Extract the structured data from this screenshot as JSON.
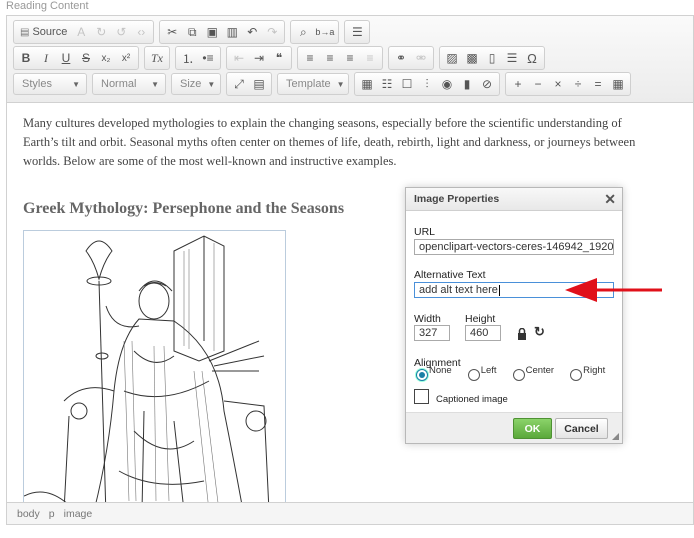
{
  "field_label": "Reading Content",
  "toolbar": {
    "row1": [
      {
        "name": "source-button",
        "label": "Source",
        "icon": "source-icon"
      },
      {
        "name": "cut-button",
        "label": "✂",
        "icon": "cut-icon"
      },
      {
        "name": "copy-button",
        "label": "⧉",
        "icon": "copy-icon"
      },
      {
        "name": "paste-button",
        "label": "📋",
        "icon": "paste-icon"
      },
      {
        "name": "paste-text-button",
        "label": "📄",
        "icon": "paste-text-icon"
      },
      {
        "name": "undo-button",
        "label": "↶",
        "icon": "undo-icon"
      },
      {
        "name": "redo-button",
        "label": "↷",
        "icon": "redo-icon"
      },
      {
        "name": "find-button",
        "label": "🔍",
        "icon": "find-icon"
      },
      {
        "name": "replace-button",
        "label": "ab",
        "icon": "replace-icon"
      },
      {
        "name": "select-all-button",
        "label": "☰",
        "icon": "select-all-icon"
      }
    ],
    "bold": "B",
    "italic": "I",
    "underline": "U",
    "strike": "S",
    "subscript": "x₂",
    "superscript": "x²",
    "remove_format": "Tx",
    "special_char": "Ω",
    "styles_label": "Styles",
    "format_label": "Normal",
    "size_label": "Size",
    "template_label": "Template",
    "math_plus": "+",
    "math_minus": "−",
    "math_times": "×",
    "math_div": "÷",
    "math_eq": "="
  },
  "content": {
    "paragraph": "Many cultures developed mythologies to explain the changing seasons, especially before the scientific understanding of Earth’s tilt and orbit. Seasonal myths often center on themes of life, death, rebirth, light and darkness, or journeys between worlds. Below are some of the most well-known and instructive examples.",
    "heading": "Greek Mythology: Persephone and the Seasons"
  },
  "statusbar": [
    "body",
    "p",
    "image"
  ],
  "dialog": {
    "title": "Image Properties",
    "url_label": "URL",
    "url_value": "openclipart-vectors-ceres-146942_1920",
    "alt_label": "Alternative Text",
    "alt_value": "add alt text here",
    "width_label": "Width",
    "width_value": "327",
    "height_label": "Height",
    "height_value": "460",
    "alignment_label": "Alignment",
    "align_options": [
      "None",
      "Left",
      "Center",
      "Right"
    ],
    "align_selected": "None",
    "captioned_label": "Captioned image",
    "ok_label": "OK",
    "cancel_label": "Cancel"
  },
  "colors": {
    "arrow": "#e0101a",
    "ok": "#5aa83a",
    "focus": "#4a90d9"
  }
}
